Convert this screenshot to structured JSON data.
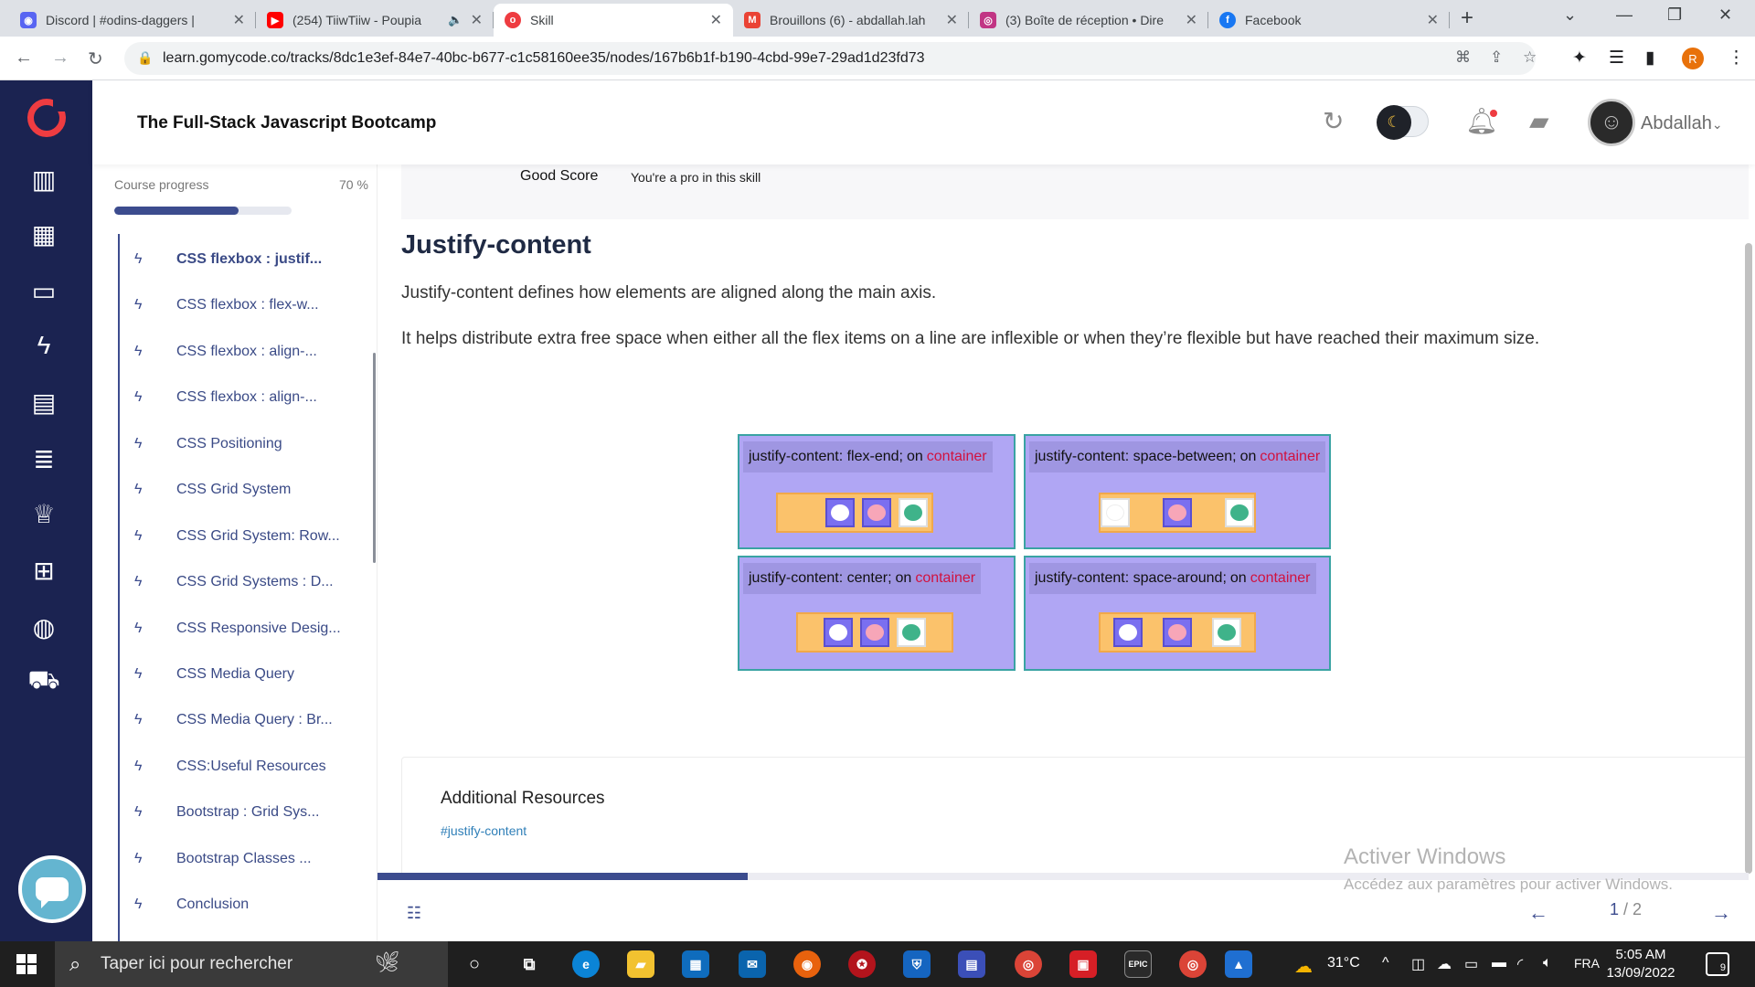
{
  "browser": {
    "tabs": [
      {
        "title": "Discord | #odins-daggers | ",
        "fav_color": "#5865f2",
        "fav_glyph": "discord-icon",
        "active": false
      },
      {
        "title": "(254) TiiwTiiw - Poupia",
        "fav_color": "#ff0000",
        "fav_glyph": "youtube-icon",
        "active": false
      },
      {
        "title": "Skill",
        "fav_color": "#ee3c41",
        "fav_glyph": "gomycode-icon",
        "active": true
      },
      {
        "title": "Brouillons (6) - abdallah.lah",
        "fav_color": "#ea4335",
        "fav_glyph": "gmail-icon",
        "active": false
      },
      {
        "title": "(3) Boîte de réception • Dire",
        "fav_color": "#c13584",
        "fav_glyph": "instagram-icon",
        "active": false
      },
      {
        "title": "Facebook",
        "fav_color": "#1877f2",
        "fav_glyph": "facebook-icon",
        "active": false
      }
    ],
    "url": "learn.gomycode.co/tracks/8dc1e3ef-84e7-40bc-b677-c1c58160ee35/nodes/167b6b1f-b190-4cbd-99e7-29ad1d23fd73",
    "profile_initial": "R"
  },
  "header": {
    "course_title": "The Full-Stack Javascript Bootcamp",
    "username": "Abdallah"
  },
  "sidebar": {
    "progress_label": "Course progress",
    "progress_text": "70 %",
    "progress_value": 0.7,
    "lessons": [
      {
        "label": "CSS flexbox : justif...",
        "active": true
      },
      {
        "label": "CSS flexbox : flex-w...",
        "active": false
      },
      {
        "label": "CSS flexbox : align-...",
        "active": false
      },
      {
        "label": "CSS flexbox : align-...",
        "active": false
      },
      {
        "label": "CSS Positioning",
        "active": false
      },
      {
        "label": "CSS Grid System",
        "active": false
      },
      {
        "label": "CSS Grid System: Row...",
        "active": false
      },
      {
        "label": "CSS Grid Systems : D...",
        "active": false
      },
      {
        "label": "CSS Responsive Desig...",
        "active": false
      },
      {
        "label": "CSS Media Query",
        "active": false
      },
      {
        "label": "CSS Media Query : Br...",
        "active": false
      },
      {
        "label": "CSS:Useful Resources",
        "active": false
      },
      {
        "label": "Bootstrap : Grid Sys...",
        "active": false
      },
      {
        "label": "Bootstrap Classes ...",
        "active": false
      },
      {
        "label": "Conclusion",
        "active": false
      }
    ]
  },
  "content": {
    "score_title": "Good Score",
    "score_subtitle": "You're a pro in this skill",
    "title": "Justify-content",
    "paragraph1": "Justify-content defines how elements are aligned along the main axis.",
    "paragraph2": "It helps distribute extra free space when either all the flex items on a line are inflexible or when they’re flexible but have reached their maximum size.",
    "illustration": {
      "panels": [
        {
          "property": "justify-content: flex-end;",
          "on": "on",
          "target": "container"
        },
        {
          "property": "justify-content: space-between;",
          "on": "on",
          "target": "container"
        },
        {
          "property": "justify-content: center;",
          "on": "on",
          "target": "container"
        },
        {
          "property": "justify-content: space-around;",
          "on": "on",
          "target": "container"
        }
      ]
    },
    "resources_title": "Additional Resources",
    "resources_tag": "#justify-content"
  },
  "pager": {
    "current": "1",
    "separator": " / ",
    "total": "2",
    "step_progress": 0.27
  },
  "watermark": {
    "line1": "Activer Windows",
    "line2": "Accédez aux paramètres pour activer Windows."
  },
  "taskbar": {
    "search_placeholder": "Taper ici pour rechercher",
    "weather": "31°C",
    "language": "FRA",
    "time": "5:05 AM",
    "date": "13/09/2022",
    "notifications": "9"
  },
  "colors": {
    "rail": "#1b2351",
    "accent": "#3c4c8e",
    "brand": "#ee3c41",
    "keyword": "#d1123f",
    "illustration_bg": "#b0a6f4"
  }
}
